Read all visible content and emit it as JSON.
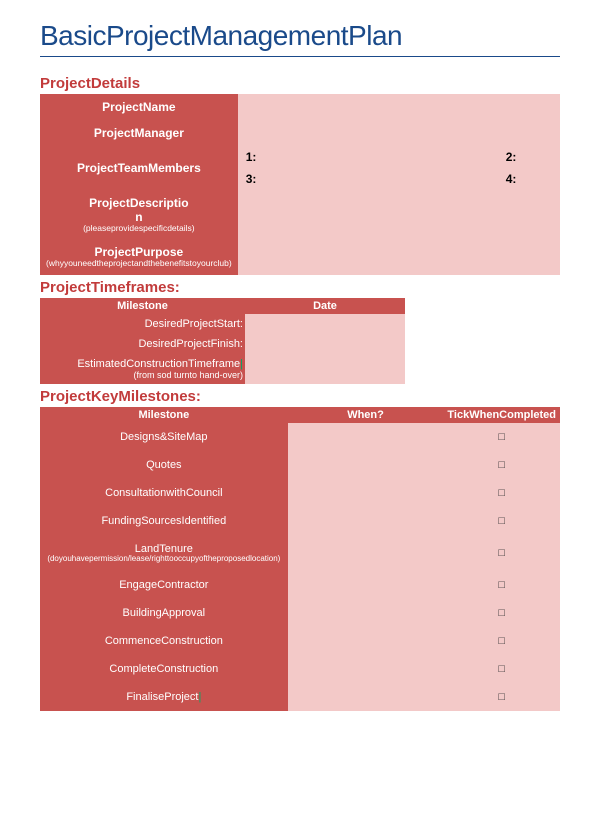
{
  "title": "BasicProjectManagementPlan",
  "sections": {
    "details": {
      "heading": "ProjectDetails",
      "rows": {
        "name": {
          "label": "ProjectName",
          "sub": ""
        },
        "manager": {
          "label": "ProjectManager",
          "sub": ""
        },
        "team": {
          "label": "ProjectTeamMembers",
          "sub": "",
          "m1": "1:",
          "m2": "2:",
          "m3": "3:",
          "m4": "4:"
        },
        "desc": {
          "label": "ProjectDescriptio\nn",
          "sub": "(pleaseprovidespecificdetails)"
        },
        "purpose": {
          "label": "ProjectPurpose",
          "sub": "(whyyouneedtheprojectandthebenefitstoyourclub)"
        }
      }
    },
    "timeframes": {
      "heading": "ProjectTimeframes:",
      "cols": {
        "milestone": "Milestone",
        "date": "Date"
      },
      "rows": [
        {
          "label": "DesiredProjectStart:",
          "sub": ""
        },
        {
          "label": "DesiredProjectFinish:",
          "sub": ""
        },
        {
          "label": "EstimatedConstructionTimeframe",
          "sub": "(from sod turnto hand-over)"
        }
      ]
    },
    "milestones": {
      "heading": "ProjectKeyMilestones:",
      "cols": {
        "milestone": "Milestone",
        "when": "When?",
        "tick": "TickWhenCompleted"
      },
      "rows": [
        {
          "label": "Designs&SiteMap",
          "sub": "",
          "tick": "□"
        },
        {
          "label": "Quotes",
          "sub": "",
          "tick": "□"
        },
        {
          "label": "ConsultationwithCouncil",
          "sub": "",
          "tick": "□"
        },
        {
          "label": "FundingSourcesIdentified",
          "sub": "",
          "tick": "□"
        },
        {
          "label": "LandTenure",
          "sub": "(doyouhavepermission/lease/righttooccupyoftheproposedlocation)",
          "tick": "□"
        },
        {
          "label": "EngageContractor",
          "sub": "",
          "tick": "□"
        },
        {
          "label": "BuildingApproval",
          "sub": "",
          "tick": "□"
        },
        {
          "label": "CommenceConstruction",
          "sub": "",
          "tick": "□"
        },
        {
          "label": "CompleteConstruction",
          "sub": "",
          "tick": "□"
        },
        {
          "label": "FinaliseProject",
          "sub": "",
          "tick": "□"
        }
      ]
    }
  }
}
